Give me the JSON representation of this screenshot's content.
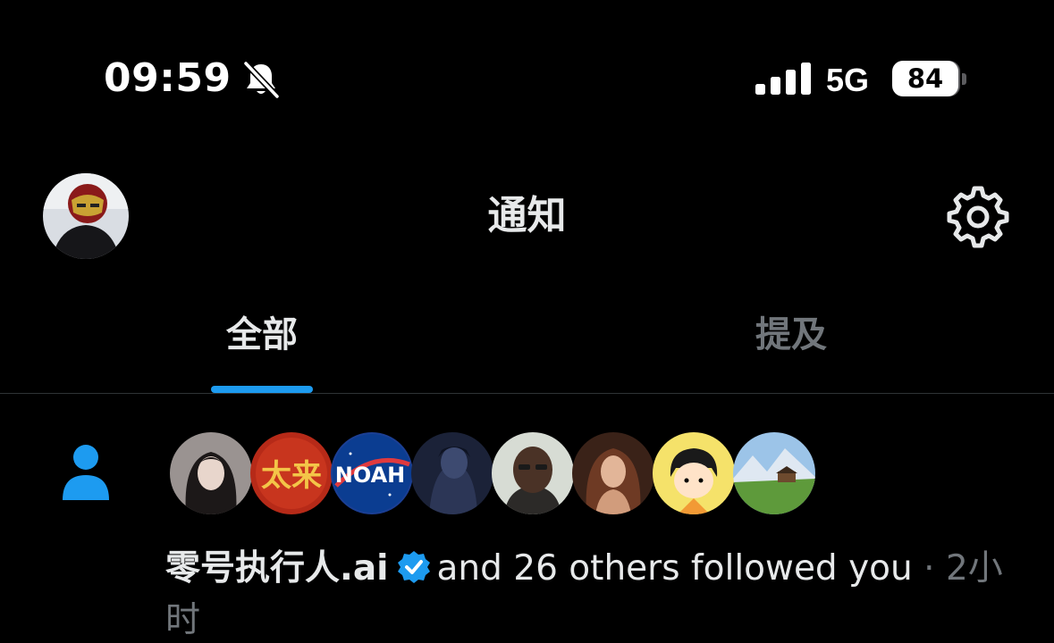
{
  "status_bar": {
    "time": "09:59",
    "network": "5G",
    "battery": "84",
    "battery_level": 0.84,
    "icons": [
      "bell-slash-icon",
      "cellular-signal-icon",
      "battery-icon"
    ]
  },
  "header": {
    "title": "通知",
    "icons": [
      "profile-avatar",
      "gear-icon"
    ]
  },
  "tabs": [
    {
      "label": "全部",
      "active": true
    },
    {
      "label": "提及",
      "active": false
    }
  ],
  "notification": {
    "type_icon": "person-icon",
    "avatar_count": 8,
    "name": "零号执行人.ai",
    "verified_icon": "verified-badge-icon",
    "action": "and 26 others followed you",
    "separator": "·",
    "time": "2小时"
  },
  "colors": {
    "accent": "#1d9bf0",
    "background": "#000000",
    "text_primary": "#e7e9ea",
    "text_secondary": "#71767b"
  }
}
